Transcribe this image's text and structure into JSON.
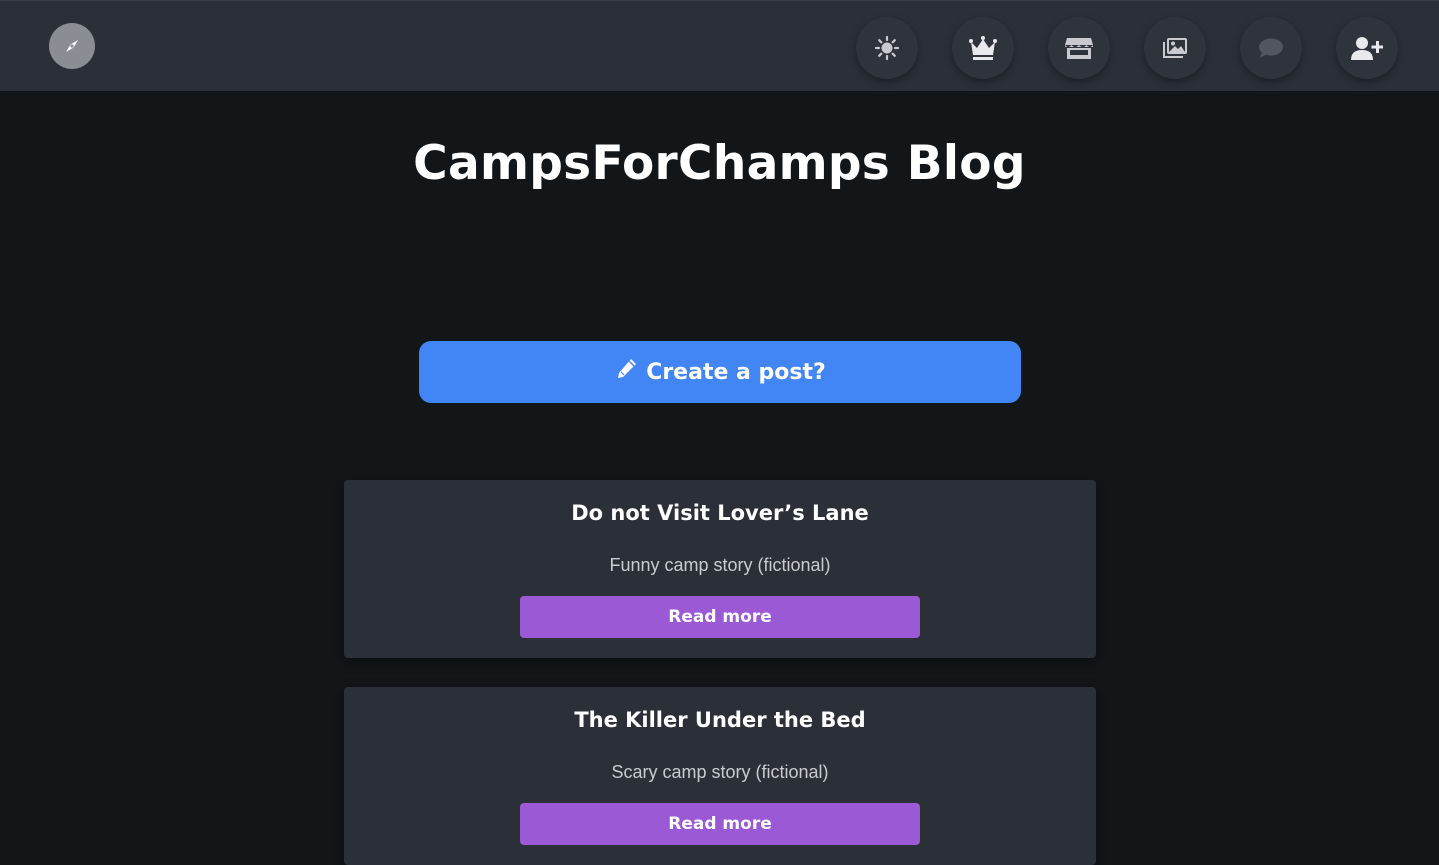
{
  "nav": {
    "logo_icon": "compass-icon",
    "icons": [
      {
        "name": "sun-icon"
      },
      {
        "name": "crown-icon"
      },
      {
        "name": "store-icon"
      },
      {
        "name": "images-icon"
      },
      {
        "name": "chat-icon"
      },
      {
        "name": "user-plus-icon"
      }
    ]
  },
  "page": {
    "title": "CampsForChamps Blog"
  },
  "create": {
    "label": "Create a post?",
    "icon": "pencil-icon",
    "color": "#4285f4"
  },
  "posts": [
    {
      "title": "Do not Visit Lover’s Lane",
      "subtitle": "Funny camp story (fictional)",
      "button": "Read more"
    },
    {
      "title": "The Killer Under the Bed",
      "subtitle": "Scary camp story (fictional)",
      "button": "Read more"
    }
  ],
  "colors": {
    "background": "#121619",
    "navbar": "#2b2f38",
    "card": "#2b2f38",
    "read_button": "#9b59d6"
  }
}
